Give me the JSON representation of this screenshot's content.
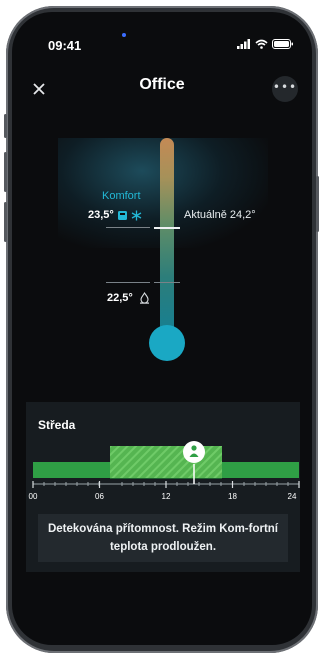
{
  "status_bar": {
    "time": "09:41"
  },
  "header": {
    "title": "Office",
    "close_icon": "close-icon",
    "more_icon": "more-icon"
  },
  "thermostat": {
    "comfort_label": "Komfort",
    "comfort_temp": "23,5°",
    "current_text": "Aktuálně 24,2°",
    "eco_temp": "22,5°",
    "colors": {
      "accent": "#22b8d6",
      "bulb": "#1aa8c4",
      "warm": "#c48a55"
    }
  },
  "schedule": {
    "day": "Středa",
    "ticks": [
      "00",
      "06",
      "12",
      "18",
      "24"
    ],
    "presence_icon": "person-pin-icon",
    "colors": {
      "base": "#2f9f45",
      "comfort": "#5cbf57"
    }
  },
  "message": "Detekována přítomnost. Režim Kom-fortní teplota prodloužen."
}
